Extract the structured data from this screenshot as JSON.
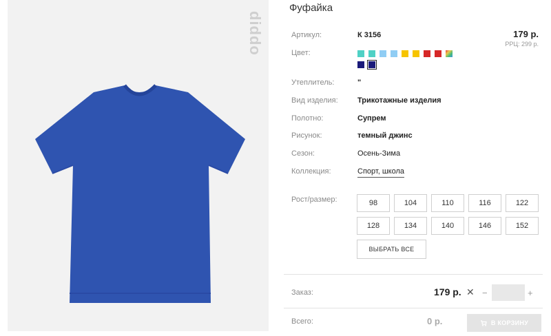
{
  "brand": "diddo",
  "product": {
    "title": "Фуфайка",
    "price": "179 р.",
    "rrp": "РРЦ: 299 р."
  },
  "details": {
    "article_label": "Артикул:",
    "article_value": "К 3156",
    "color_label": "Цвет:",
    "insulation_label": "Утеплитель:",
    "insulation_value": "\"",
    "type_label": "Вид изделия:",
    "type_value": "Трикотажные изделия",
    "fabric_label": "Полотно:",
    "fabric_value": "Супрем",
    "pattern_label": "Рисунок:",
    "pattern_value": "темный джинс",
    "season_label": "Сезон:",
    "season_value": "Осень-Зима",
    "collection_label": "Коллекция:",
    "collection_value": "Спорт, школа"
  },
  "colors": [
    "#4fd1c5",
    "#4fd1c5",
    "#90cdf4",
    "#90cdf4",
    "#f6c400",
    "#f6c400",
    "#d62828",
    "#d62828",
    "rainbow",
    "#1a1a7a",
    "#1a1a7a"
  ],
  "selected_color_index": 10,
  "sizes": {
    "label": "Рост/размер:",
    "options": [
      "98",
      "104",
      "110",
      "116",
      "122",
      "128",
      "134",
      "140",
      "146",
      "152"
    ],
    "select_all": "ВЫБРАТЬ ВСЕ"
  },
  "order": {
    "label": "Заказ:",
    "price": "179 р.",
    "times": "✕",
    "minus": "−",
    "plus": "+",
    "quantity": ""
  },
  "total": {
    "label": "Всего:",
    "value": "0 р.",
    "cart_button": "В КОРЗИНУ"
  },
  "icons": [
    "cart-icon",
    "close-icon"
  ]
}
